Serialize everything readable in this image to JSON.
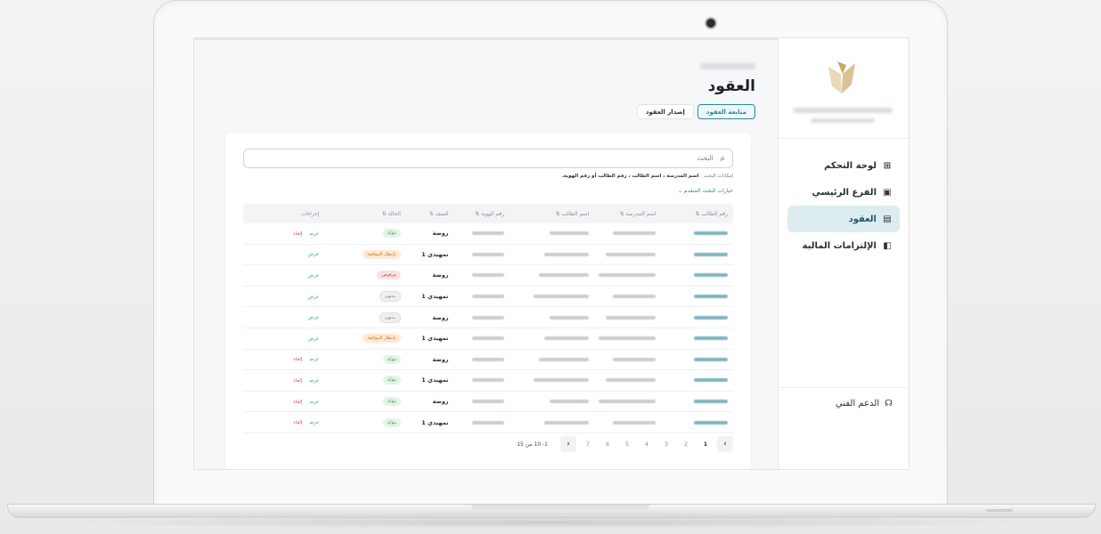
{
  "sidebar": {
    "items": [
      {
        "label": "لوحة التحكم",
        "icon": "grid-icon",
        "glyph": "⊞",
        "active": false
      },
      {
        "label": "الفرع الرئيسي",
        "icon": "building-icon",
        "glyph": "▣",
        "active": false
      },
      {
        "label": "العقود",
        "icon": "document-icon",
        "glyph": "▤",
        "active": true
      },
      {
        "label": "الإلتزامات المالية",
        "icon": "wallet-icon",
        "glyph": "◧",
        "active": false
      }
    ],
    "support_label": "الدعم الفني",
    "support_icon": "headset-icon"
  },
  "header": {
    "title": "العقود",
    "tabs": [
      "متابعة العقود",
      "إصدار العقود"
    ]
  },
  "search": {
    "placeholder": "البحث",
    "hint_prefix": "إمكانات البحث :",
    "hint_fields": "اسم المدرسة ، اسم الطالب ، رقم الطالب أو رقم الهوية.",
    "advanced_label": "خيارات البحث المتقدم ⌄"
  },
  "table": {
    "headers": [
      "رقم الطالب ⇅",
      "اسم المدرسة ⇅",
      "اسم الطالب ⇅",
      "رقم الهوية ⇅",
      "الصف ⇅",
      "الحالة ⇅",
      "إجراءات"
    ],
    "rows": [
      {
        "grade": "روضة",
        "status": "مؤكد",
        "status_color": "green",
        "actions": [
          "عرض",
          "إلغاء"
        ]
      },
      {
        "grade": "تمهيدي 1",
        "status": "بإنتظار الموافقة",
        "status_color": "orange",
        "actions": [
          "عرض"
        ]
      },
      {
        "grade": "روضة",
        "status": "مرفوض",
        "status_color": "red",
        "actions": [
          "عرض"
        ]
      },
      {
        "grade": "تمهيدي 1",
        "status": "منتهي",
        "status_color": "gray",
        "actions": [
          "عرض"
        ]
      },
      {
        "grade": "روضة",
        "status": "منتهي",
        "status_color": "gray",
        "actions": [
          "عرض"
        ]
      },
      {
        "grade": "تمهيدي 1",
        "status": "بإنتظار الموافقة",
        "status_color": "orange",
        "actions": [
          "عرض"
        ]
      },
      {
        "grade": "روضة",
        "status": "مؤكد",
        "status_color": "green",
        "actions": [
          "عرض",
          "إلغاء"
        ]
      },
      {
        "grade": "تمهيدي 1",
        "status": "مؤكد",
        "status_color": "green",
        "actions": [
          "عرض",
          "إلغاء"
        ]
      },
      {
        "grade": "روضة",
        "status": "مؤكد",
        "status_color": "green",
        "actions": [
          "عرض",
          "إلغاء"
        ]
      },
      {
        "grade": "تمهيدي 1",
        "status": "مؤكد",
        "status_color": "green",
        "actions": [
          "عرض",
          "إلغاء"
        ]
      }
    ]
  },
  "pagination": {
    "pages": [
      "1",
      "2",
      "3",
      "4",
      "5",
      "6",
      "7"
    ],
    "current": "1",
    "info": "1- 10 من 15"
  },
  "colors": {
    "accent": "#2a8a9a",
    "active_nav_bg": "#dcecef"
  }
}
